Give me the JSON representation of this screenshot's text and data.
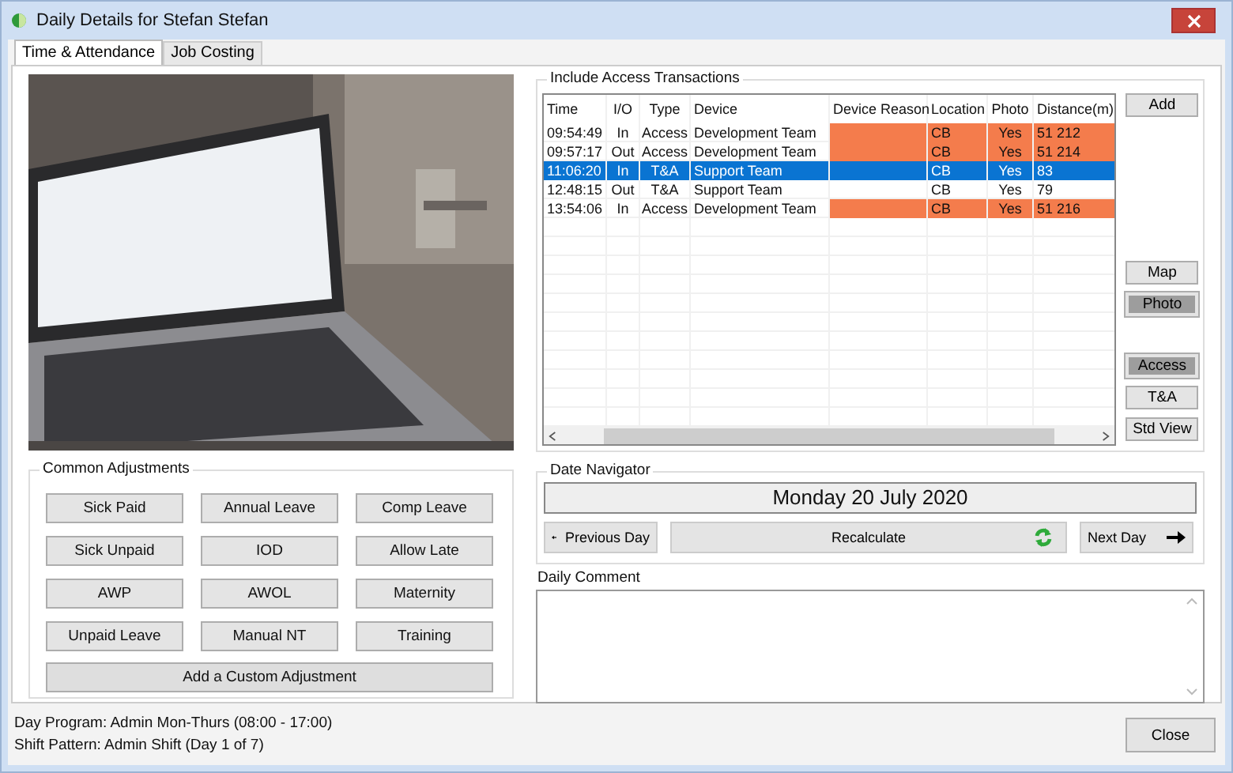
{
  "window": {
    "title": "Daily Details for Stefan Stefan"
  },
  "tabs": [
    {
      "label": "Time & Attendance",
      "selected": true
    },
    {
      "label": "Job Costing",
      "selected": false
    }
  ],
  "photo": {
    "kind": "picture"
  },
  "transactions": {
    "title": "Include Access Transactions",
    "columns": [
      "Time",
      "I/O",
      "Type",
      "Device",
      "Device Reason",
      "Location",
      "Photo",
      "Distance(m)"
    ],
    "rows": [
      {
        "cells": [
          "09:54:49",
          "In",
          "Access",
          "Development Team",
          "",
          "CB",
          "Yes",
          "51 212"
        ],
        "flagged": true,
        "selected": false
      },
      {
        "cells": [
          "09:57:17",
          "Out",
          "Access",
          "Development Team",
          "",
          "CB",
          "Yes",
          "51 214"
        ],
        "flagged": true,
        "selected": false
      },
      {
        "cells": [
          "11:06:20",
          "In",
          "T&A",
          "Support Team",
          "",
          "CB",
          "Yes",
          "83"
        ],
        "flagged": false,
        "selected": true
      },
      {
        "cells": [
          "12:48:15",
          "Out",
          "T&A",
          "Support Team",
          "",
          "CB",
          "Yes",
          "79"
        ],
        "flagged": false,
        "selected": false
      },
      {
        "cells": [
          "13:54:06",
          "In",
          "Access",
          "Development Team",
          "",
          "CB",
          "Yes",
          "51 216"
        ],
        "flagged": true,
        "selected": false
      }
    ]
  },
  "side_buttons": [
    {
      "buttons": [
        {
          "label": "Add",
          "pressed": false
        }
      ]
    },
    {
      "buttons": [
        {
          "label": "Map",
          "pressed": false
        },
        {
          "label": "Photo",
          "pressed": true
        }
      ]
    },
    {
      "buttons": [
        {
          "label": "Access",
          "pressed": true
        },
        {
          "label": "T&A",
          "pressed": false
        },
        {
          "label": "Std View",
          "pressed": false
        }
      ]
    }
  ],
  "adjustments": {
    "title": "Common Adjustments",
    "buttons": [
      "Sick Paid",
      "Annual Leave",
      "Comp Leave",
      "Sick Unpaid",
      "IOD",
      "Allow Late",
      "AWP",
      "AWOL",
      "Maternity",
      "Unpaid Leave",
      "Manual NT",
      "Training"
    ],
    "custom_button": "Add a Custom Adjustment"
  },
  "date_navigator": {
    "title": "Date Navigator",
    "date": "Monday 20 July 2020",
    "previous": "Previous Day",
    "recalculate": "Recalculate",
    "next": "Next Day"
  },
  "daily_comment": {
    "label": "Daily Comment"
  },
  "status_lines": [
    "Day Program:  Admin Mon-Thurs  (08:00 - 17:00)",
    "Shift Pattern:  Admin Shift  (Day 1 of 7)"
  ],
  "close_button": "Close"
}
